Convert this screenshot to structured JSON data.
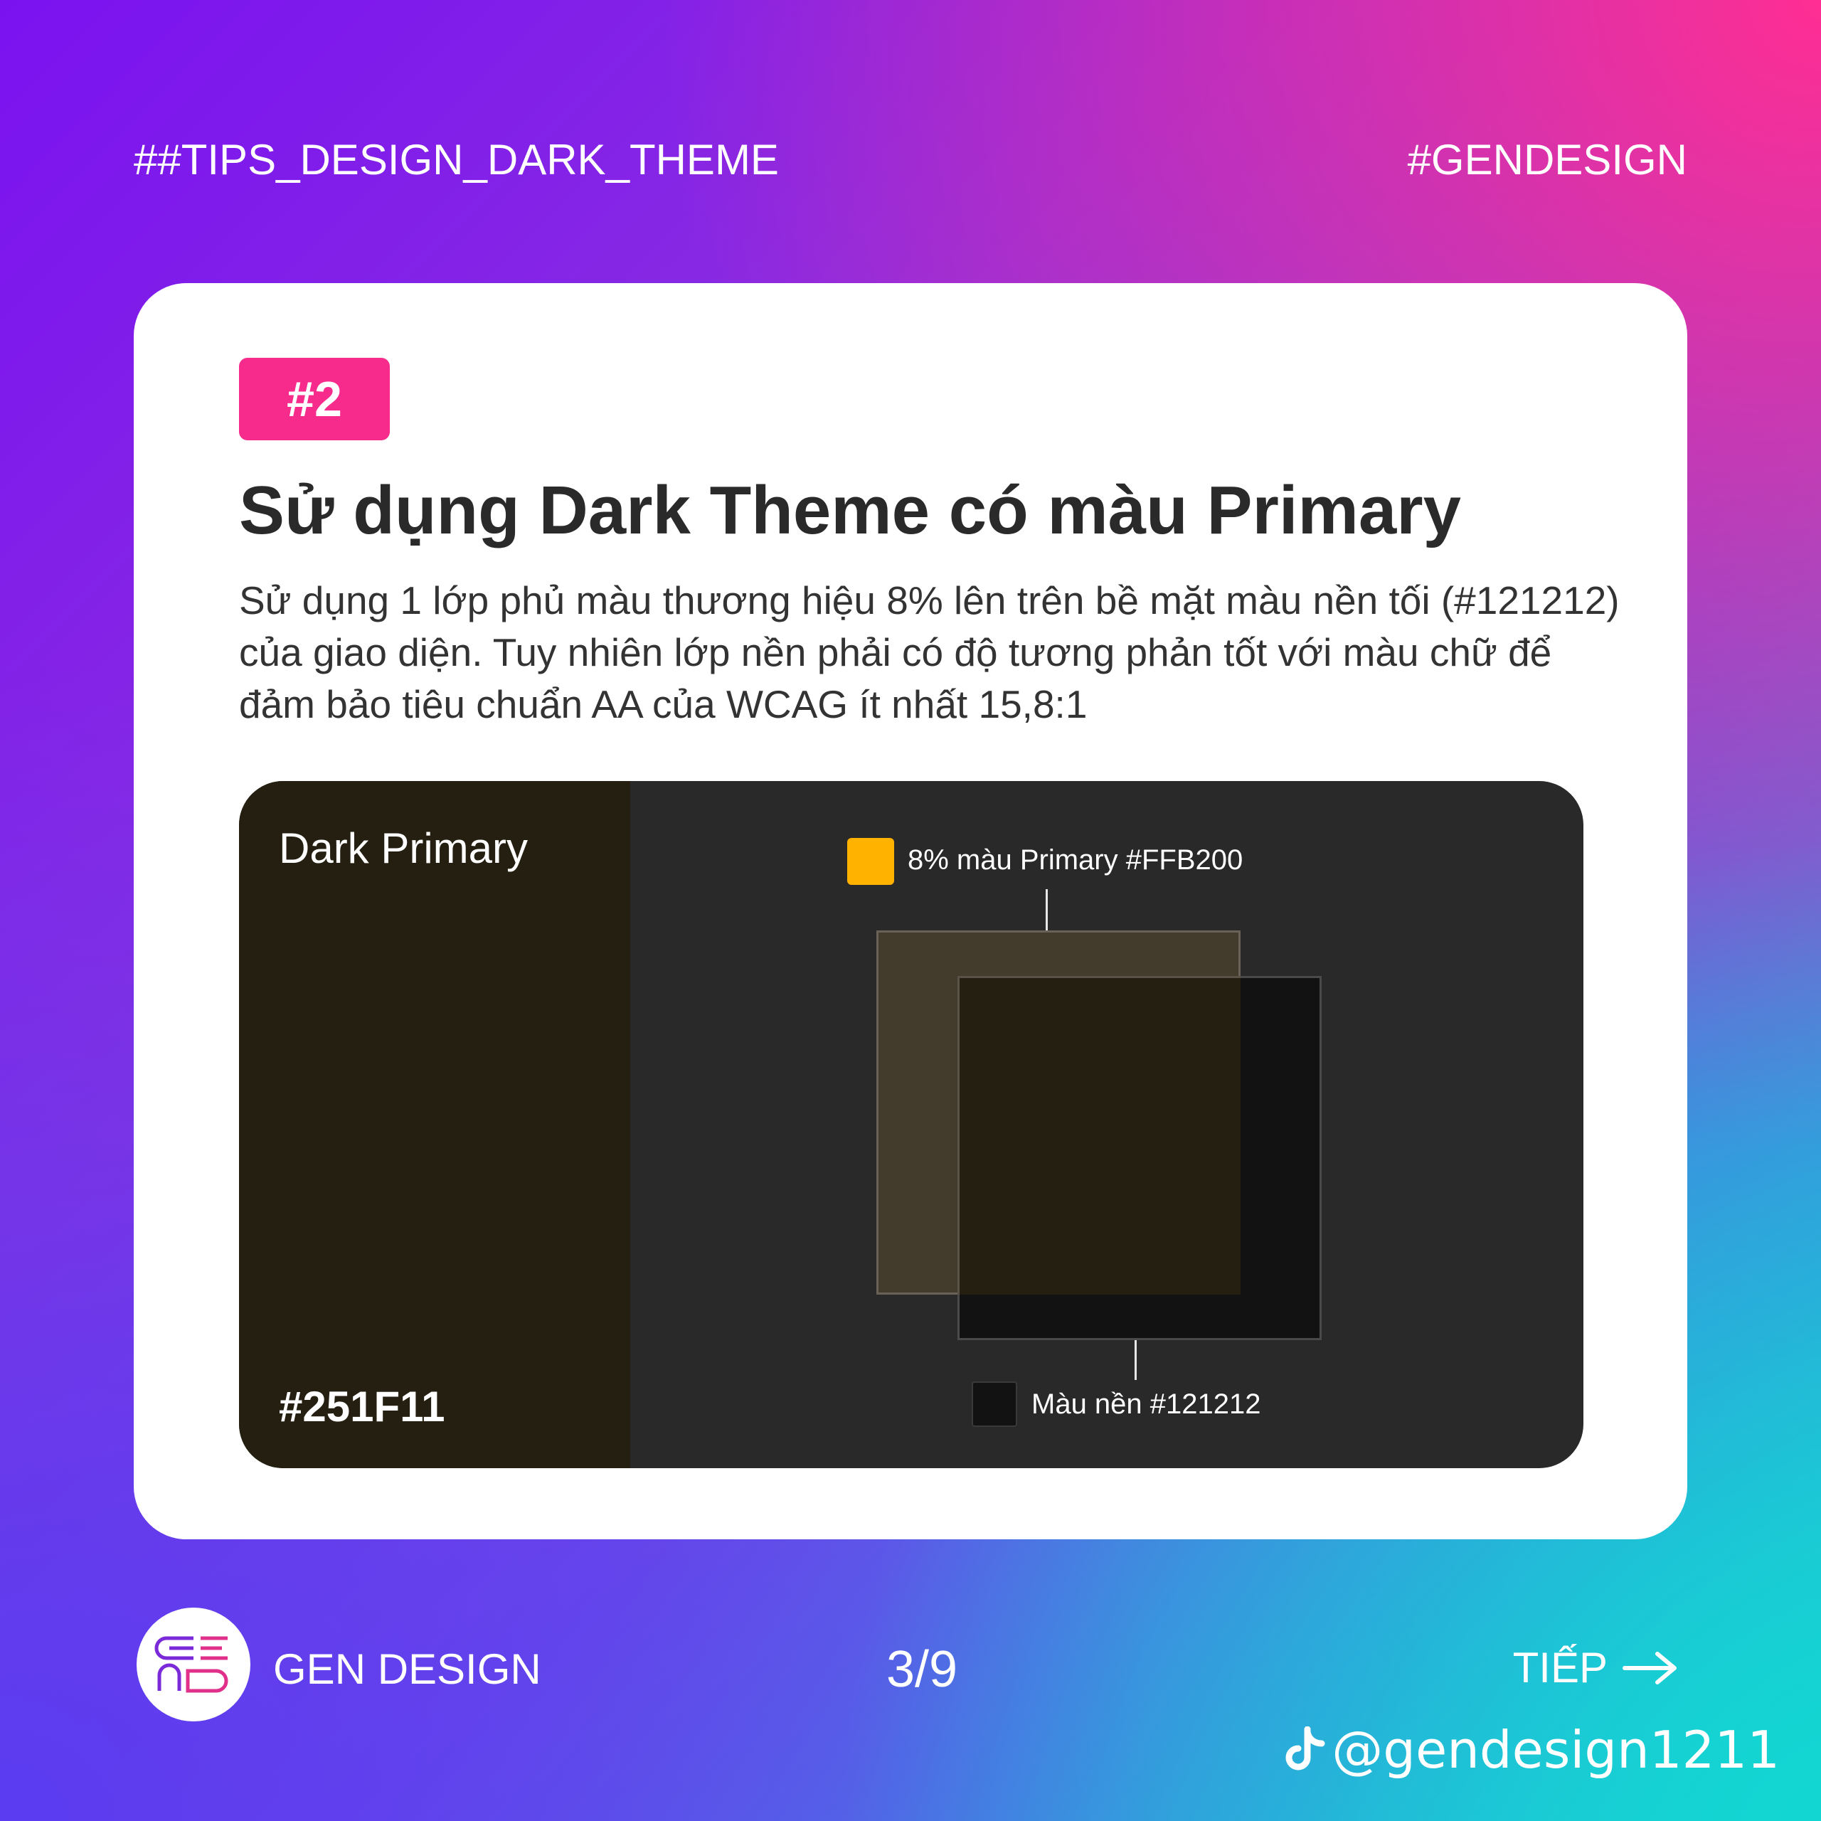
{
  "header": {
    "tag_left": "##TIPS_DESIGN_DARK_THEME",
    "tag_right": "#GENDESIGN"
  },
  "card": {
    "badge": "#2",
    "title": "Sử dụng Dark Theme có màu Primary",
    "description": "Sử dụng 1 lớp phủ màu thương hiệu 8% lên trên bề mặt màu nền tối (#121212) của giao diện. Tuy nhiên lớp nền phải có độ tương phản tốt với màu chữ để đảm bảo tiêu chuẩn AA của WCAG ít nhất 15,8:1",
    "demo": {
      "panel_label": "Dark Primary",
      "panel_hex": "#251F11",
      "legend_primary": "8% màu Primary #FFB200",
      "legend_background": "Màu nền #121212",
      "colors": {
        "dark_primary": "#251F11",
        "primary": "#FFB200",
        "background": "#121212"
      }
    }
  },
  "footer": {
    "brand": "GEN DESIGN",
    "pager": "3/9",
    "next_label": "TIẾP",
    "handle": "@gendesign1211"
  },
  "icons": {
    "next": "arrow-right-icon",
    "tiktok": "tiktok-icon",
    "logo": "gen-design-logo"
  }
}
